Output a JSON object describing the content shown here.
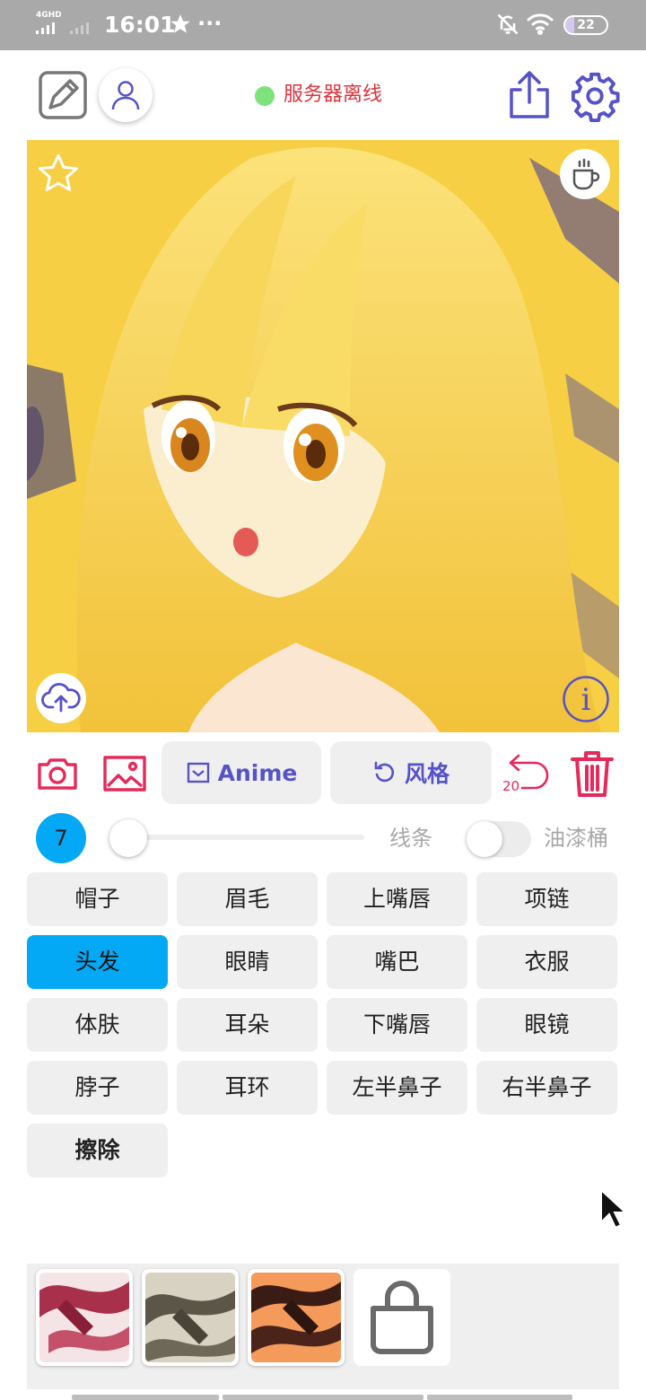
{
  "status_bar": {
    "network": "4GHD",
    "time": "16:01",
    "battery": "22",
    "battery_level_percent": 22,
    "icons": [
      "signal-icon",
      "star-icon",
      "more-dots-icon",
      "bell-off-icon",
      "wifi-icon",
      "battery-icon"
    ],
    "dots": "···"
  },
  "header": {
    "server_status": "服务器离线",
    "server_status_color": "#7ee27a",
    "icons": [
      "edit-icon",
      "user-icon",
      "share-icon",
      "settings-gear-icon"
    ]
  },
  "canvas": {
    "overlay_icons": [
      "star-outline-icon",
      "coffee-cup-icon",
      "cloud-upload-icon",
      "info-icon"
    ],
    "info_glyph": "i"
  },
  "toolbar": {
    "anime_label": "Anime",
    "style_label": "风格",
    "undo_count": "20",
    "accent_color": "#e52a5a",
    "pill_text_color": "#5652c7"
  },
  "brush": {
    "size": "7",
    "lines_label": "线条",
    "bucket_label": "油漆桶",
    "bucket_enabled": false,
    "slider_level": 0.0
  },
  "parts": [
    {
      "label": "帽子",
      "active": false
    },
    {
      "label": "眉毛",
      "active": false
    },
    {
      "label": "上嘴唇",
      "active": false
    },
    {
      "label": "项链",
      "active": false
    },
    {
      "label": "头发",
      "active": true
    },
    {
      "label": "眼睛",
      "active": false
    },
    {
      "label": "嘴巴",
      "active": false
    },
    {
      "label": "衣服",
      "active": false
    },
    {
      "label": "体肤",
      "active": false
    },
    {
      "label": "耳朵",
      "active": false
    },
    {
      "label": "下嘴唇",
      "active": false
    },
    {
      "label": "眼镜",
      "active": false
    },
    {
      "label": "脖子",
      "active": false
    },
    {
      "label": "耳环",
      "active": false
    },
    {
      "label": "左半鼻子",
      "active": false
    },
    {
      "label": "右半鼻子",
      "active": false
    },
    {
      "label": "擦除",
      "active": false
    }
  ],
  "palette": {
    "swatches": [
      "style-swatch-red",
      "style-swatch-gray",
      "style-swatch-orange"
    ],
    "shop_icon": "shopping-bag-icon"
  }
}
